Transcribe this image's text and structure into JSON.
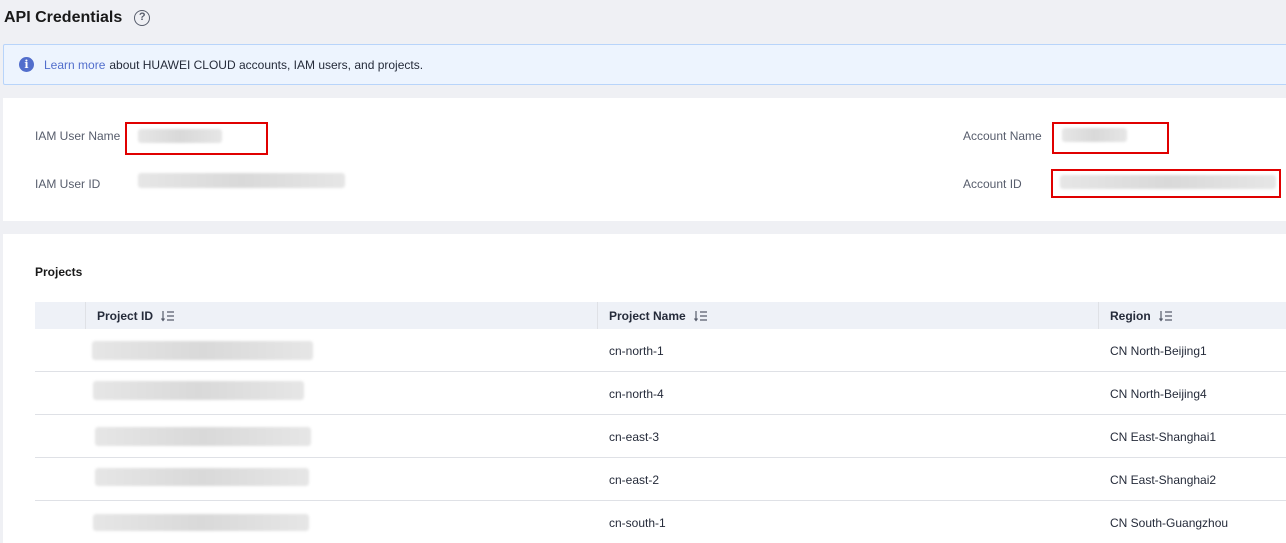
{
  "header": {
    "title": "API Credentials"
  },
  "banner": {
    "link_text": "Learn more",
    "text": "about HUAWEI CLOUD accounts, IAM users, and projects."
  },
  "account": {
    "iam_user_name_label": "IAM User Name",
    "iam_user_id_label": "IAM User ID",
    "account_name_label": "Account Name",
    "account_id_label": "Account ID"
  },
  "projects": {
    "title": "Projects",
    "columns": [
      "Project ID",
      "Project Name",
      "Region"
    ],
    "rows": [
      {
        "name": "cn-north-1",
        "region": "CN North-Beijing1"
      },
      {
        "name": "cn-north-4",
        "region": "CN North-Beijing4"
      },
      {
        "name": "cn-east-3",
        "region": "CN East-Shanghai1"
      },
      {
        "name": "cn-east-2",
        "region": "CN East-Shanghai2"
      },
      {
        "name": "cn-south-1",
        "region": "CN South-Guangzhou"
      }
    ]
  },
  "colors": {
    "accent": "#526ecc",
    "highlight": "#e00000",
    "banner_bg": "#edf4fe"
  },
  "icons": [
    "help-circle-icon",
    "info-icon",
    "sort-icon"
  ]
}
